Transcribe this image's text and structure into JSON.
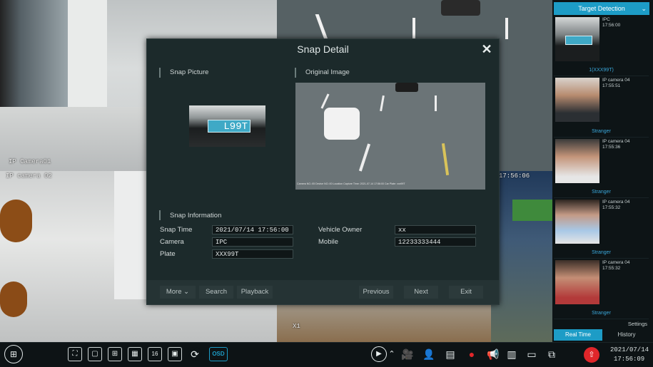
{
  "cameras": [
    {
      "label": "IP Camera01"
    },
    {
      "label": "IP camera 02"
    },
    {
      "label": "17:56:06"
    },
    {
      "label": "X1"
    }
  ],
  "snap_detail": {
    "title": "Snap Detail",
    "close_icon": "close-icon",
    "snap_picture_title": "Snap Picture",
    "original_image_title": "Original Image",
    "plate_text": "L99T",
    "original_caption": "Camera NO.:05  Device NO.:00  Location  Capture Time: 2021-07-14 17:56:00  Car Plate: xxx99T",
    "info_title": "Snap Information",
    "fields_left": [
      {
        "label": "Snap Time",
        "value": "2021/07/14 17:56:00"
      },
      {
        "label": "Camera",
        "value": "IPC"
      },
      {
        "label": "Plate",
        "value": "XXX99T"
      }
    ],
    "fields_right": [
      {
        "label": "Vehicle Owner",
        "value": "xx"
      },
      {
        "label": "Mobile",
        "value": "12233333444"
      }
    ],
    "buttons": {
      "more": "More",
      "search": "Search",
      "playback": "Playback",
      "previous": "Previous",
      "next": "Next",
      "exit": "Exit"
    }
  },
  "side_panel": {
    "header": "Target Detection",
    "items": [
      {
        "source": "IPC",
        "time": "17:56:00",
        "caption": "1(XXX99T)"
      },
      {
        "source": "IP camera 04",
        "time": "17:55:51",
        "caption": "Stranger"
      },
      {
        "source": "IP camera 04",
        "time": "17:55:36",
        "caption": "Stranger"
      },
      {
        "source": "IP camera 04",
        "time": "17:55:32",
        "caption": "Stranger"
      },
      {
        "source": "IP camera 04",
        "time": "17:55:32",
        "caption": "Stranger"
      }
    ],
    "settings": "Settings",
    "tabs": {
      "realtime": "Real Time",
      "history": "History"
    }
  },
  "toolbar": {
    "osd": "OSD",
    "layout16": "16",
    "date": "2021/07/14",
    "time": "17:56:09"
  },
  "colors": {
    "accent": "#1d9cc6",
    "modal_bg": "#1c2a2b",
    "alert_red": "#e0262a"
  }
}
